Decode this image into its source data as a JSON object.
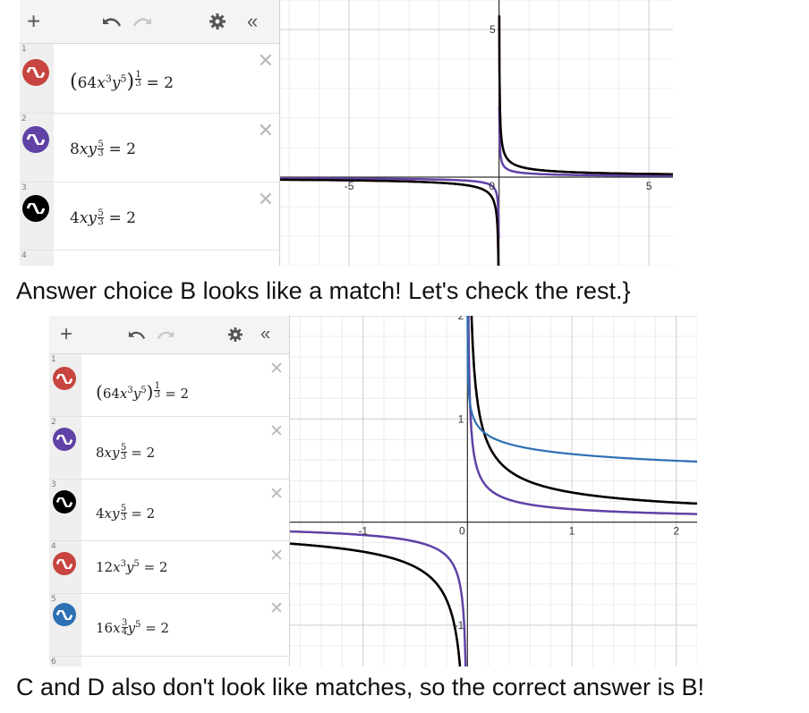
{
  "panel1": {
    "rows": [
      {
        "index": "1",
        "color": "#c74440",
        "icon": "wave-icon",
        "expr": {
          "open": "(",
          "c": "64",
          "x": "x",
          "xe": "3",
          "y": "y",
          "ye": "5",
          "close": ")",
          "num": "1",
          "den": "3",
          "rhs": "= 2"
        }
      },
      {
        "index": "2",
        "color": "#6042a6",
        "icon": "wave-icon",
        "expr": {
          "c": "8",
          "x": "x",
          "y": "y",
          "num": "5",
          "den": "3",
          "rhs": "= 2"
        }
      },
      {
        "index": "3",
        "color": "#000000",
        "icon": "wave-icon",
        "expr": {
          "c": "4",
          "x": "x",
          "y": "y",
          "num": "5",
          "den": "3",
          "rhs": "= 2"
        }
      },
      {
        "index": "4"
      }
    ],
    "graph": {
      "xticks": [
        "-5",
        "0",
        "5"
      ],
      "ytick": "5"
    }
  },
  "caption1": "Answer choice B looks like a match! Let's check the rest.}",
  "panel2": {
    "rows": [
      {
        "index": "1",
        "color": "#c74440",
        "icon": "wave-icon",
        "expr": {
          "open": "(",
          "c": "64",
          "x": "x",
          "xe": "3",
          "y": "y",
          "ye": "5",
          "close": ")",
          "num": "1",
          "den": "3",
          "rhs": "= 2"
        }
      },
      {
        "index": "2",
        "color": "#6042a6",
        "icon": "wave-icon",
        "expr": {
          "c": "8",
          "x": "x",
          "y": "y",
          "num": "5",
          "den": "3",
          "rhs": "= 2"
        }
      },
      {
        "index": "3",
        "color": "#000000",
        "icon": "wave-icon",
        "expr": {
          "c": "4",
          "x": "x",
          "y": "y",
          "num": "5",
          "den": "3",
          "rhs": "= 2"
        }
      },
      {
        "index": "4",
        "color": "#c74440",
        "icon": "wave-icon",
        "expr": {
          "c": "12",
          "x": "x",
          "xe": "3",
          "y": "y",
          "ye": "5",
          "rhs": "= 2"
        }
      },
      {
        "index": "5",
        "color": "#2d70b3",
        "icon": "wave-icon",
        "expr": {
          "c": "16",
          "x": "x",
          "num": "3",
          "den": "4",
          "y": "y",
          "ye": "5",
          "rhs": "= 2"
        }
      },
      {
        "index": "6"
      }
    ],
    "graph": {
      "xticks": [
        "-1",
        "0",
        "1",
        "2"
      ],
      "yticks": [
        "2",
        "1",
        "-1"
      ]
    }
  },
  "caption2": "C and D also don't look like matches, so the correct answer is B!",
  "colors": {
    "red": "#c74440",
    "purple": "#6042a6",
    "black": "#000000",
    "blue": "#2d70b3"
  }
}
